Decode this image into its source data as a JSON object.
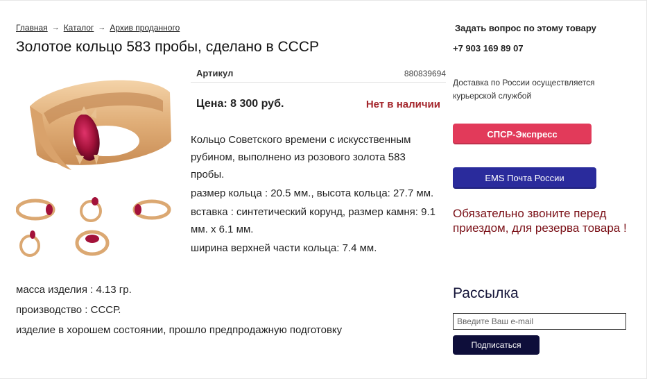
{
  "breadcrumb": {
    "items": [
      "Главная",
      "Каталог",
      "Архив проданного"
    ],
    "separator": "→"
  },
  "product": {
    "title": "Золотое кольцо 583 пробы, сделано в СССР",
    "article_label": "Артикул",
    "article_value": "880839694",
    "price": "Цена: 8 300 руб.",
    "availability": "Нет в наличии",
    "description": [
      "Кольцо Советского времени с искусственным рубином, выполнено из розового золота 583 пробы.",
      "размер кольца : 20.5 мм., высота кольца: 27.7 мм.",
      "вставка : синтетический корунд, размер камня: 9.1 мм. х 6.1 мм.",
      "ширина верхней части кольца: 7.4 мм."
    ],
    "description_wide": [
      "масса изделия : 4.13 гр.",
      "производство : СССР.",
      "изделие в хорошем состоянии, прошло предпродажную подготовку"
    ]
  },
  "sidebar": {
    "ask_question": "Задать вопрос по этому товару",
    "phone": "+7 903 169 89 07",
    "delivery_text": "Доставка по России осуществляется курьерской службой",
    "spsr_button": "СПСР-Экспресс",
    "ems_button": "EMS Почта России",
    "warning": "Обязательно звоните перед приездом, для резерва товара !",
    "newsletter_title": "Рассылка",
    "email_placeholder": "Введите Ваш e-mail",
    "subscribe_button": "Подписаться"
  },
  "colors": {
    "spsr": "#e23a5a",
    "ems": "#2a2b9c",
    "subscribe": "#0e0e3a",
    "availability": "#a4262c",
    "warning": "#7a0f16",
    "gold": "#e0b07a",
    "ruby": "#a3123a"
  }
}
